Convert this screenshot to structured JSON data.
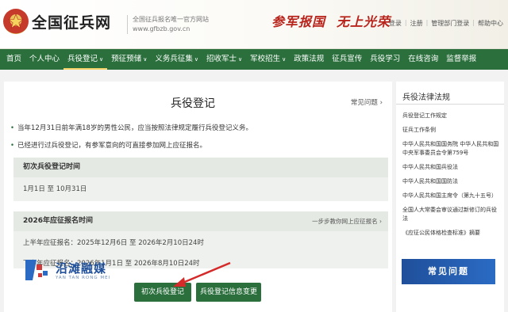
{
  "header": {
    "site_title": "全国征兵网",
    "site_sub_line1": "全国征兵报名唯一官方网站",
    "site_sub_line2": "www.gfbzb.gov.cn",
    "slogan_1": "参军报国",
    "slogan_2": "无上光荣",
    "links": [
      "登录",
      "注册",
      "管理部门登录",
      "帮助中心"
    ]
  },
  "nav": {
    "items": [
      {
        "label": "首页",
        "caret": false
      },
      {
        "label": "个人中心",
        "caret": false
      },
      {
        "label": "兵役登记",
        "caret": true,
        "active": true
      },
      {
        "label": "预征预储",
        "caret": true
      },
      {
        "label": "义务兵征集",
        "caret": true
      },
      {
        "label": "招收军士",
        "caret": true
      },
      {
        "label": "军校招生",
        "caret": true
      },
      {
        "label": "政策法规",
        "caret": false
      },
      {
        "label": "征兵宣传",
        "caret": false
      },
      {
        "label": "兵役学习",
        "caret": false
      },
      {
        "label": "在线咨询",
        "caret": false
      },
      {
        "label": "监督举报",
        "caret": false
      }
    ],
    "caret_glyph": "∨"
  },
  "main": {
    "title": "兵役登记",
    "faq_link": "常见问题",
    "bullets": [
      "当年12月31日前年满18岁的男性公民，应当按照法律规定履行兵役登记义务。",
      "已经进行过兵役登记，有参军意向的可直接参加网上应征报名。"
    ],
    "panel1": {
      "title": "初次兵役登记时间",
      "body": "1月1日 至 10月31日"
    },
    "panel2": {
      "title": "2026年应征报名时间",
      "right_link": "一步步教你网上应征报名",
      "line1": "上半年应征报名：2025年12月6日 至 2026年2月10日24时",
      "line2": "下半年应征报名：2026年1月1日 至 2026年8月10日24时"
    },
    "buttons": {
      "first_registration": "初次兵役登记",
      "change_info": "兵役登记信息变更"
    }
  },
  "sidebar": {
    "title": "兵役法律法规",
    "items": [
      "兵役登记工作规定",
      "征兵工作条例",
      "中华人民共和国国务院 中华人民共和国中央军事委员会令第759号",
      "中华人民共和国兵役法",
      "中华人民共和国国防法",
      "中华人民共和国主席令（第九十五号）",
      "全国人大常委会审议通过新修订的兵役法",
      "《应征公民体格检查标准》摘要"
    ],
    "banner": "常见问题"
  },
  "watermark": {
    "text": "沿滩融媒",
    "sub": "YAN TAN RONG MEI"
  },
  "colors": {
    "nav_green": "#2a6f3c",
    "slogan_red": "#b8231b",
    "banner_blue": "#1f4f9a"
  }
}
